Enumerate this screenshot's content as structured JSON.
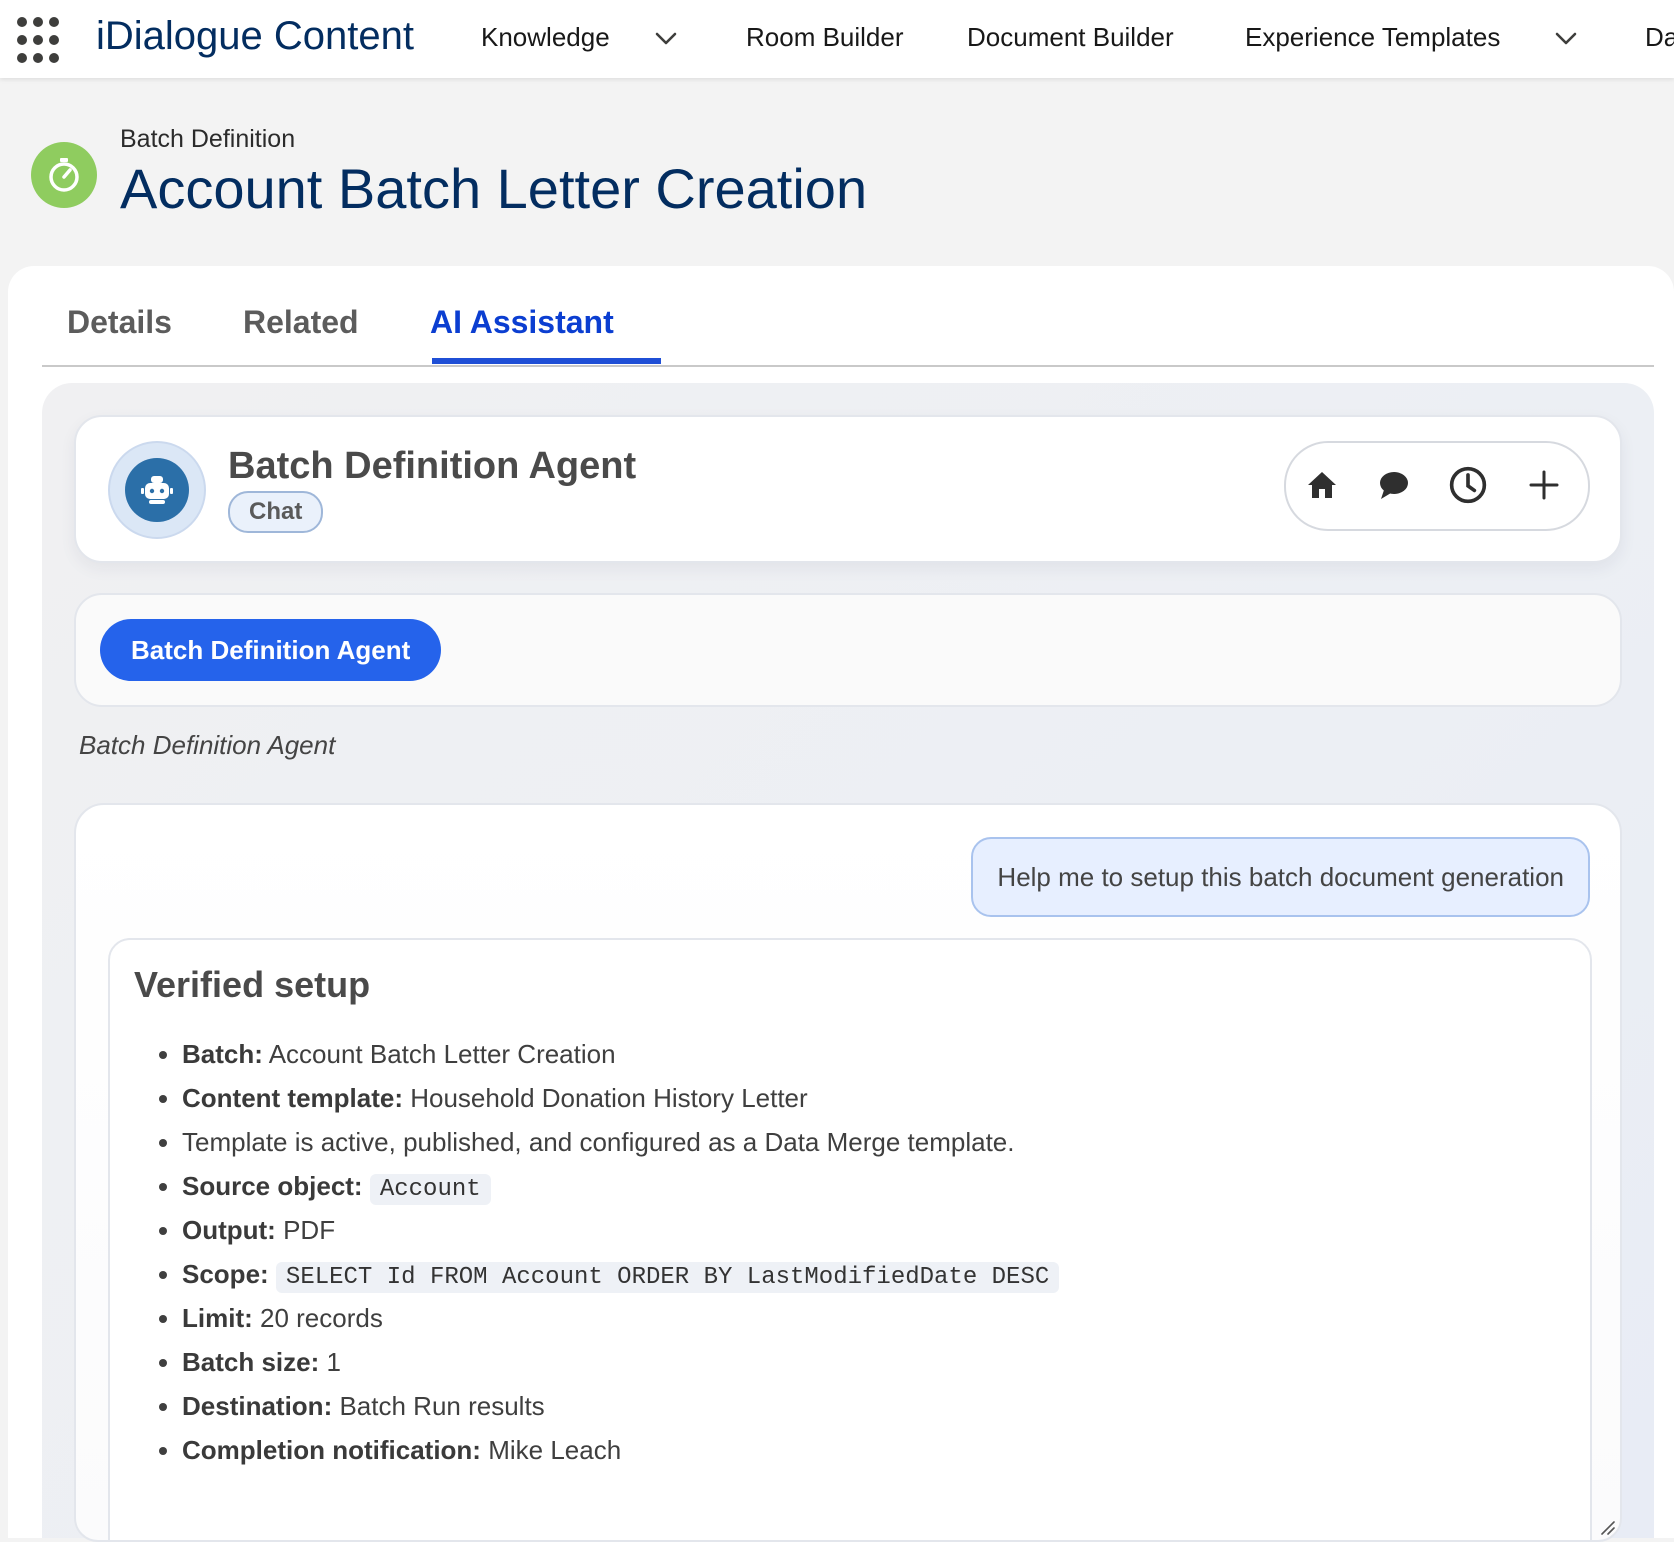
{
  "nav": {
    "app_name": "iDialogue Content",
    "items": [
      {
        "label": "Knowledge",
        "has_menu": true
      },
      {
        "label": "Room Builder",
        "has_menu": false
      },
      {
        "label": "Document Builder",
        "has_menu": false
      },
      {
        "label": "Experience Templates",
        "has_menu": true
      },
      {
        "label": "Da",
        "has_menu": false
      }
    ]
  },
  "record": {
    "type_label": "Batch Definition",
    "title": "Account Batch Letter Creation",
    "icon": "stopwatch-icon",
    "icon_color": "#8fcc5f"
  },
  "tabs": [
    {
      "label": "Details",
      "active": false
    },
    {
      "label": "Related",
      "active": false
    },
    {
      "label": "AI Assistant",
      "active": true
    }
  ],
  "agent": {
    "title": "Batch Definition Agent",
    "mode_pill": "Chat",
    "actions": [
      "home-icon",
      "chat-bubble-icon",
      "history-clock-icon",
      "plus-icon"
    ],
    "selected_agent_button": "Batch Definition Agent",
    "agent_label": "Batch Definition Agent",
    "accent_color": "#2563eb"
  },
  "conversation": {
    "user_message": "Help me to setup this batch document generation",
    "reply": {
      "heading": "Verified setup",
      "items": [
        {
          "label": "Batch:",
          "value": "Account Batch Letter Creation",
          "code": false
        },
        {
          "label": "Content template:",
          "value": "Household Donation History Letter",
          "code": false
        },
        {
          "label": "",
          "value": "Template is active, published, and configured as a Data Merge template.",
          "code": false
        },
        {
          "label": "Source object:",
          "value": "Account",
          "code": true
        },
        {
          "label": "Output:",
          "value": "PDF",
          "code": false
        },
        {
          "label": "Scope:",
          "value": "SELECT Id FROM Account ORDER BY LastModifiedDate DESC",
          "code": true
        },
        {
          "label": "Limit:",
          "value": "20 records",
          "code": false
        },
        {
          "label": "Batch size:",
          "value": "1",
          "code": false
        },
        {
          "label": "Destination:",
          "value": "Batch Run results",
          "code": false
        },
        {
          "label": "Completion notification:",
          "value": "Mike Leach",
          "code": false
        }
      ]
    }
  }
}
